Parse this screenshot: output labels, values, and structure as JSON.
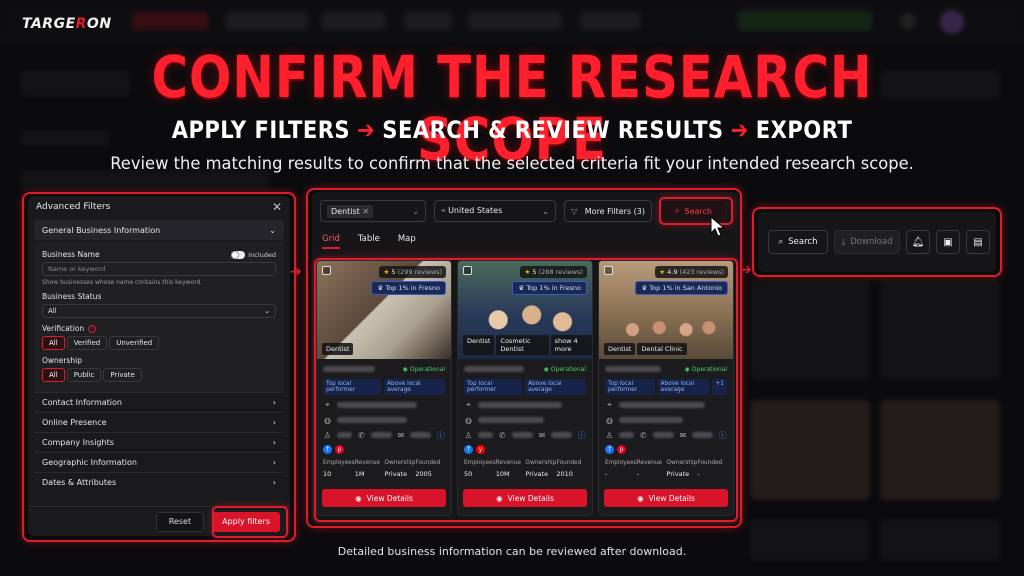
{
  "logo": {
    "text_main": "TARGE",
    "text_accent": "R",
    "text_tail": "ON"
  },
  "headline": "CONFIRM THE RESEARCH SCOPE",
  "steps": {
    "step1": "APPLY FILTERS",
    "step2": "SEARCH & REVIEW RESULTS",
    "step3": "EXPORT",
    "arrow": "➔"
  },
  "subline": "Review the matching results to confirm that the selected criteria fit your intended research scope.",
  "filters": {
    "title": "Advanced Filters",
    "open_section": "General Business Information",
    "business_name_label": "Business Name",
    "included_label": "Included",
    "business_name_placeholder": "Name or keyword",
    "business_name_hint": "Show businesses whose name contains this keyword.",
    "business_status_label": "Business Status",
    "business_status_value": "All",
    "verification_label": "Verification",
    "verification_options": [
      "All",
      "Verified",
      "Unverified"
    ],
    "ownership_label": "Ownership",
    "ownership_options": [
      "All",
      "Public",
      "Private"
    ],
    "sections": [
      "Contact Information",
      "Online Presence",
      "Company Insights",
      "Geographic Information",
      "Dates & Attributes"
    ],
    "reset_label": "Reset",
    "apply_label": "Apply filters"
  },
  "results": {
    "category_chip": "Dentist",
    "location_chip": "United States",
    "more_filters": "More Filters (3)",
    "search_label": "Search",
    "tabs": [
      "Grid",
      "Table",
      "Map"
    ],
    "cards": [
      {
        "rating": "5",
        "reviews": "(299 reviews)",
        "badge": "Top 1% in Fresno",
        "tags": [
          "Dentist"
        ],
        "status": "Operational",
        "perf": [
          "Top local performer",
          "Above local average"
        ],
        "socials": [
          "f",
          "p"
        ],
        "stat_labels": [
          "Employees",
          "Revenue",
          "Ownership",
          "Founded"
        ],
        "stat_values": [
          "10",
          "1M",
          "Private",
          "2005"
        ],
        "cta": "View Details"
      },
      {
        "rating": "5",
        "reviews": "(288 reviews)",
        "badge": "Top 1% in Fresno",
        "tags": [
          "Dentist",
          "Cosmetic Dentist",
          "show 4 more"
        ],
        "status": "Operational",
        "perf": [
          "Top local performer",
          "Above local average"
        ],
        "socials": [
          "f",
          "y"
        ],
        "stat_labels": [
          "Employees",
          "Revenue",
          "Ownership",
          "Founded"
        ],
        "stat_values": [
          "50",
          "10M",
          "Private",
          "2010"
        ],
        "cta": "View Details"
      },
      {
        "rating": "4.9",
        "reviews": "(423 reviews)",
        "badge": "Top 1% in San Antonio",
        "tags": [
          "Dentist",
          "Dental Clinic"
        ],
        "status": "Operational",
        "perf": [
          "Top local performer",
          "Above local average",
          "+1"
        ],
        "socials": [
          "f",
          "p"
        ],
        "stat_labels": [
          "Employees",
          "Revenue",
          "Ownership",
          "Founded"
        ],
        "stat_values": [
          "-",
          "-",
          "Private",
          "-"
        ],
        "cta": "View Details"
      }
    ]
  },
  "actions": {
    "search_label": "Search",
    "download_label": "Download"
  },
  "footnote": "Detailed business information can be reviewed after download.",
  "colors": {
    "accent": "#e21b2c",
    "bg": "#0b0b0d",
    "panel": "#1a1a1c"
  },
  "icons": [
    "close-icon",
    "chevron-down-icon",
    "chevron-right-icon",
    "location-pin-icon",
    "filter-icon",
    "search-icon",
    "download-icon",
    "bell-icon",
    "terminal-icon",
    "document-icon",
    "eye-icon",
    "star-icon",
    "trophy-icon"
  ]
}
